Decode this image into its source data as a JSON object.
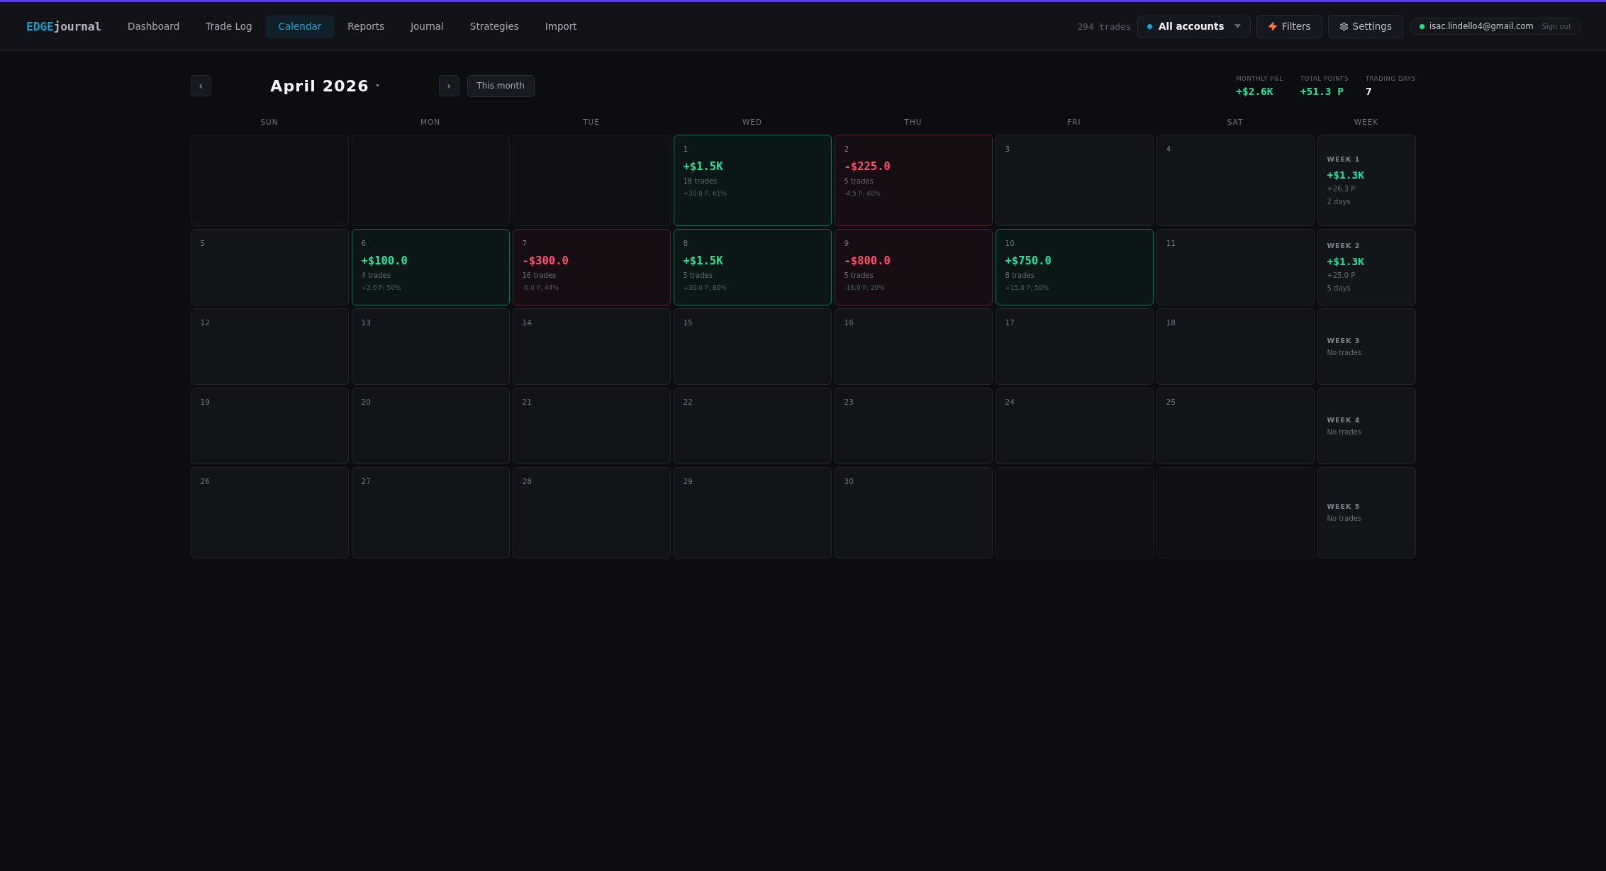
{
  "nav": {
    "logo": {
      "accent": "EDGE",
      "rest": "journal"
    },
    "items": [
      {
        "label": "Dashboard",
        "selected": false
      },
      {
        "label": "Trade Log",
        "selected": false
      },
      {
        "label": "Calendar",
        "selected": true
      },
      {
        "label": "Reports",
        "selected": false
      },
      {
        "label": "Journal",
        "selected": false
      },
      {
        "label": "Strategies",
        "selected": false
      },
      {
        "label": "Import",
        "selected": false
      }
    ],
    "trade_count": "294 trades",
    "account_select": {
      "value": "All accounts"
    },
    "buttons": [
      {
        "kind": "filters",
        "label": "Filters"
      },
      {
        "kind": "settings",
        "label": "Settings"
      }
    ],
    "user": {
      "email": "isac.lindello4@gmail.com",
      "sign_out": "Sign out"
    }
  },
  "calendar": {
    "prev": "‹",
    "title": "April 2026",
    "next": "›",
    "today_button": "This month",
    "stats": [
      {
        "kind": "gain",
        "label": "MONTHLY P&L",
        "value": "+$2.6K"
      },
      {
        "kind": "gain",
        "label": "TOTAL POINTS",
        "value": "+51.3 P"
      },
      {
        "kind": "plain",
        "label": "TRADING DAYS",
        "value": "7"
      }
    ],
    "weekdays": [
      "SUN",
      "MON",
      "TUE",
      "WED",
      "THU",
      "FRI",
      "SAT",
      "WEEK"
    ],
    "weeks": [
      {
        "days": [
          {
            "kind": "blank"
          },
          {
            "kind": "blank"
          },
          {
            "kind": "blank"
          },
          {
            "kind": "profit",
            "date": "1",
            "pnl": "+$1.5K",
            "trades": "18 trades",
            "detail": "+30.8 P, 61%"
          },
          {
            "kind": "loss",
            "date": "2",
            "pnl": "-$225.0",
            "trades": "5 trades",
            "detail": "-4.5 P, 40%"
          },
          {
            "kind": "day",
            "date": "3"
          },
          {
            "kind": "day",
            "date": "4"
          }
        ],
        "summary": {
          "kind": "profit",
          "label": "WEEK 1",
          "pnl": "+$1.3K",
          "points": "+26.3 P",
          "days": "2 days"
        }
      },
      {
        "days": [
          {
            "kind": "day",
            "date": "5"
          },
          {
            "kind": "profit",
            "date": "6",
            "pnl": "+$100.0",
            "trades": "4 trades",
            "detail": "+2.0 P, 50%"
          },
          {
            "kind": "loss",
            "date": "7",
            "pnl": "-$300.0",
            "trades": "16 trades",
            "detail": "-6.0 P, 44%"
          },
          {
            "kind": "profit",
            "date": "8",
            "pnl": "+$1.5K",
            "trades": "5 trades",
            "detail": "+30.0 P, 80%"
          },
          {
            "kind": "loss",
            "date": "9",
            "pnl": "-$800.0",
            "trades": "5 trades",
            "detail": "-16.0 P, 20%"
          },
          {
            "kind": "profit",
            "date": "10",
            "pnl": "+$750.0",
            "trades": "8 trades",
            "detail": "+15.0 P, 50%"
          },
          {
            "kind": "day",
            "date": "11"
          }
        ],
        "summary": {
          "kind": "profit",
          "label": "WEEK 2",
          "pnl": "+$1.3K",
          "points": "+25.0 P",
          "days": "5 days"
        }
      },
      {
        "days": [
          {
            "kind": "day",
            "date": "12"
          },
          {
            "kind": "day",
            "date": "13"
          },
          {
            "kind": "day",
            "date": "14"
          },
          {
            "kind": "day",
            "date": "15"
          },
          {
            "kind": "day",
            "date": "16"
          },
          {
            "kind": "day",
            "date": "17"
          },
          {
            "kind": "day",
            "date": "18"
          }
        ],
        "summary": {
          "kind": "empty",
          "label": "WEEK 3",
          "note": "No trades"
        }
      },
      {
        "days": [
          {
            "kind": "day",
            "date": "19"
          },
          {
            "kind": "day",
            "date": "20"
          },
          {
            "kind": "day",
            "date": "21"
          },
          {
            "kind": "day",
            "date": "22"
          },
          {
            "kind": "day",
            "date": "23"
          },
          {
            "kind": "day",
            "date": "24"
          },
          {
            "kind": "day",
            "date": "25"
          }
        ],
        "summary": {
          "kind": "empty",
          "label": "WEEK 4",
          "note": "No trades"
        }
      },
      {
        "days": [
          {
            "kind": "day",
            "date": "26"
          },
          {
            "kind": "day",
            "date": "27"
          },
          {
            "kind": "day",
            "date": "28"
          },
          {
            "kind": "day",
            "date": "29"
          },
          {
            "kind": "day",
            "date": "30"
          },
          {
            "kind": "blank"
          },
          {
            "kind": "blank"
          }
        ],
        "summary": {
          "kind": "empty",
          "label": "WEEK 5",
          "note": "No trades"
        }
      }
    ]
  }
}
